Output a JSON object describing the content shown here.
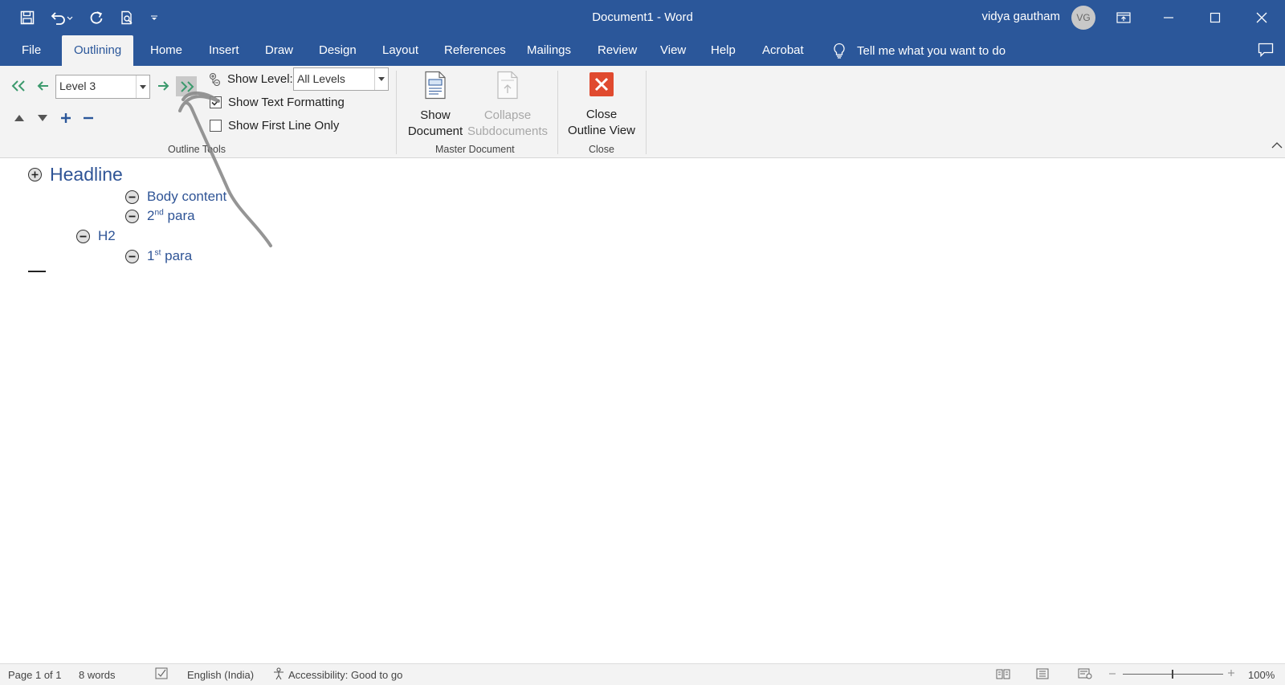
{
  "window": {
    "title": "Document1  -  Word",
    "user_name": "vidya gautham",
    "avatar_initials": "VG"
  },
  "tabs": [
    {
      "label": "File"
    },
    {
      "label": "Outlining",
      "active": true
    },
    {
      "label": "Home"
    },
    {
      "label": "Insert"
    },
    {
      "label": "Draw"
    },
    {
      "label": "Design"
    },
    {
      "label": "Layout"
    },
    {
      "label": "References"
    },
    {
      "label": "Mailings"
    },
    {
      "label": "Review"
    },
    {
      "label": "View"
    },
    {
      "label": "Help"
    },
    {
      "label": "Acrobat"
    }
  ],
  "tell_me": "Tell me what you want to do",
  "ribbon": {
    "outline_tools": {
      "level_value": "Level 3",
      "show_level_label": "Show Level:",
      "show_level_value": "All Levels",
      "show_text_formatting": "Show Text Formatting",
      "show_text_formatting_checked": true,
      "show_first_line_only": "Show First Line Only",
      "show_first_line_only_checked": false,
      "group_label": "Outline Tools"
    },
    "master_document": {
      "show_document_line1": "Show",
      "show_document_line2": "Document",
      "collapse_line1": "Collapse",
      "collapse_line2": "Subdocuments",
      "group_label": "Master Document"
    },
    "close": {
      "close_line1": "Close",
      "close_line2": "Outline View",
      "group_label": "Close"
    }
  },
  "outline": {
    "headline": "Headline",
    "body_content": "Body content",
    "second_para_num": "2",
    "second_para_sup": "nd",
    "second_para_text": " para",
    "h2": "H2",
    "first_para_num": "1",
    "first_para_sup": "st",
    "first_para_text": " para"
  },
  "status": {
    "page": "Page 1 of 1",
    "words": "8 words",
    "language": "English (India)",
    "accessibility": "Accessibility: Good to go",
    "zoom": "100%"
  },
  "colors": {
    "brand": "#2b579a",
    "outline_text": "#2f5496",
    "close_red": "#e04a2f",
    "arrow_green": "#3c9a6d"
  }
}
